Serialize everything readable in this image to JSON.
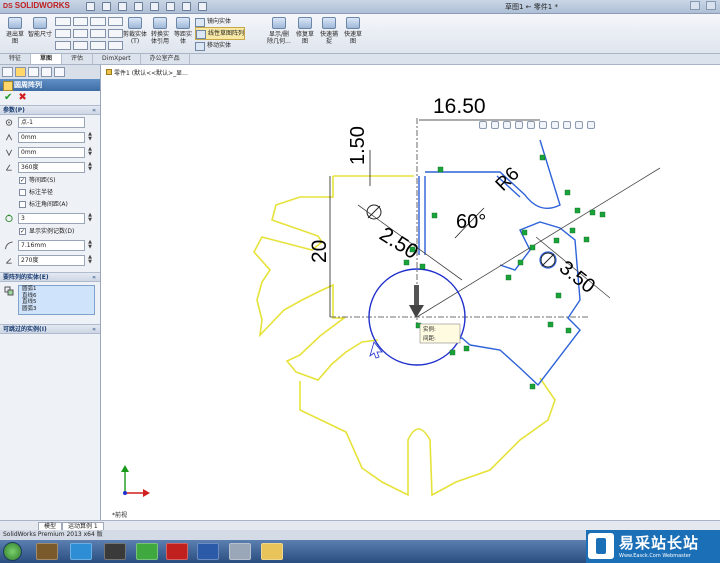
{
  "app": {
    "brand": "SOLIDWORKS",
    "brand_prefix": "DS",
    "document_title": "草图1 ← 零件1 *"
  },
  "ribbon": {
    "exit_sketch": "退出草图",
    "smart_dimension": "智能尺寸",
    "trim_entities": "剪裁实体(T)",
    "convert_entities": "转换实体引用",
    "offset_entities": "等距实体",
    "mirror_entities": "镜向实体",
    "linear_pattern": "线性草图阵列",
    "move_entities": "移动实体",
    "display_delete_relations": "显示/删除几何...",
    "repair_sketch": "修复草图",
    "rapid_sketch": "快速捕捉",
    "quick_sketch": "快速草图"
  },
  "tabs": [
    "特征",
    "草图",
    "评估",
    "DimXpert",
    "办公室产品"
  ],
  "active_tab": "草图",
  "panel": {
    "title": "圆周阵列",
    "params_header": "参数(P)",
    "center_point": "点-1",
    "x_coord": "0mm",
    "y_coord": "0mm",
    "angle": "360度",
    "equal_spacing": "等间距(S)",
    "dim_radius": "标注半径",
    "dim_angle_spacing": "标注角间距(A)",
    "instance_count": "3",
    "show_instance_count": "显示实例记数(D)",
    "radius_value": "7.16mm",
    "arc_angle": "270度",
    "entities_header": "要阵列的实体(E)",
    "entities": [
      "圆弧1",
      "直线6",
      "直线5",
      "圆弧3"
    ],
    "skipped_header": "可跳过的实例(I)"
  },
  "canvas": {
    "tree_label": "零件1 (默认<<默认>_显...",
    "dims": {
      "d1": "16.50",
      "d2": "1.50",
      "d3": "R6",
      "d4": "2.50",
      "d5": "60°",
      "d6": "20",
      "d7": "3.50"
    },
    "tooltip_line1": "实例:",
    "tooltip_line2": "间距:",
    "axis_label": "*前视"
  },
  "bottom_tabs": [
    "模型",
    "运动算例 1"
  ],
  "status_text": "SolidWorks Premium 2013 x64 版",
  "watermark": {
    "title": "易采站长站",
    "subtitle": "Www.Easck.Com  Webmaster"
  },
  "colors": {
    "sketch_blue": "#2d62d8",
    "fixed_yellow": "#e6e23a",
    "circle_blue": "#1f2fcc",
    "relation_green": "#1aa33a",
    "panel_title": "#3e6da6",
    "watermark_blue": "#1b6fb7"
  }
}
